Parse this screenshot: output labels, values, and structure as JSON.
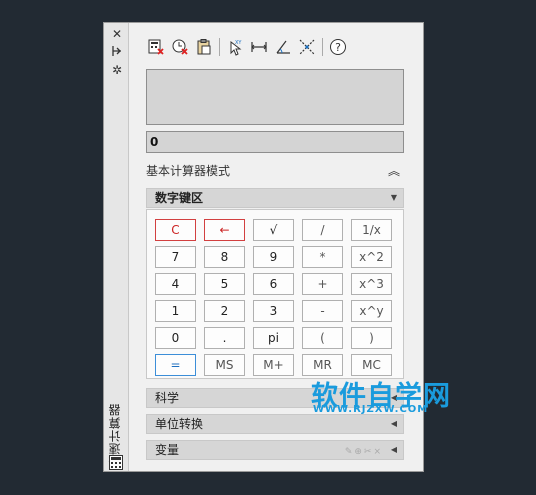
{
  "side": {
    "title": "快速计算器",
    "close_glyph": "✕",
    "pin_glyph": "⧗",
    "settings_glyph": "✲"
  },
  "toolbar": {
    "icons": [
      "clear-calculator-icon",
      "clear-history-icon",
      "paste-icon",
      "get-coordinates-icon",
      "distance-between-points-icon",
      "angle-of-line-icon",
      "intersection-icon",
      "help-icon"
    ]
  },
  "display": {
    "history": "",
    "input": "0"
  },
  "mode": {
    "label": "基本计算器模式",
    "collapse_glyph": "︽"
  },
  "sections": {
    "numpad": "数字键区",
    "scientific": "科学",
    "units": "单位转换",
    "variables": "变量"
  },
  "keys": [
    [
      "C",
      "←",
      "√",
      "/",
      "1/x"
    ],
    [
      "7",
      "8",
      "9",
      "*",
      "x^2"
    ],
    [
      "4",
      "5",
      "6",
      "+",
      "x^3"
    ],
    [
      "1",
      "2",
      "3",
      "-",
      "x^y"
    ],
    [
      "0",
      ".",
      "pi",
      "(",
      ")"
    ],
    [
      "=",
      "MS",
      "M+",
      "MR",
      "MC"
    ]
  ],
  "watermark": {
    "main": "软件自学网",
    "sub": "WWW.RJZXW.COM"
  },
  "colors": {
    "background": "#222a33",
    "panel": "#f0f0f0",
    "clear_key": "#c22",
    "equals_key": "#1e6fc0",
    "watermark": "#1a9bdd"
  }
}
